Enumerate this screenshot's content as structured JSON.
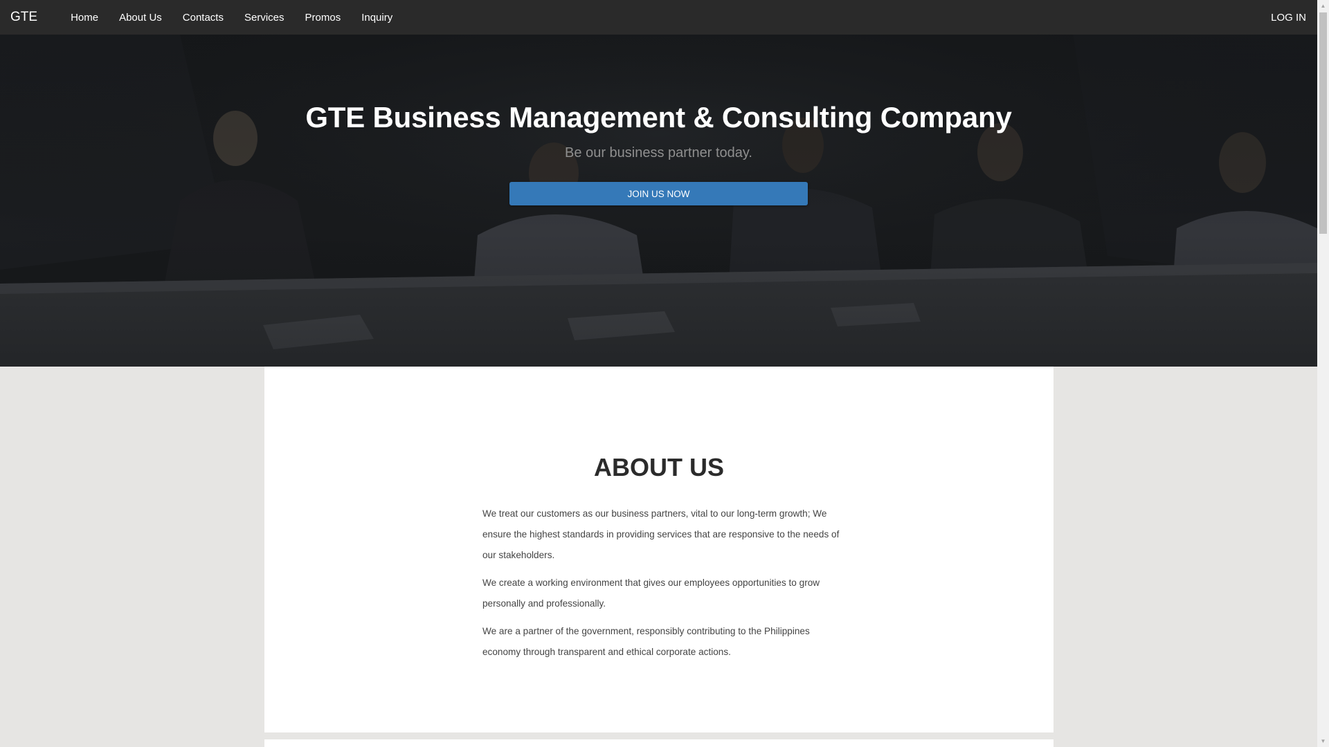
{
  "nav": {
    "brand": "GTE",
    "links": [
      "Home",
      "About Us",
      "Contacts",
      "Services",
      "Promos",
      "Inquiry"
    ],
    "login": "LOG IN"
  },
  "hero": {
    "title": "GTE Business Management & Consulting Company",
    "subtitle": "Be our business partner today.",
    "cta": "JOIN US NOW"
  },
  "about": {
    "title": "ABOUT US",
    "paragraphs": [
      "We treat our customers as our business partners, vital to our long-term growth; We ensure the highest standards in providing services that are responsive to the needs of our stakeholders.",
      "We create a working environment that gives our employees opportunities to grow personally and professionally.",
      "We are a partner of the government, responsibly contributing to the Philippines economy through transparent and ethical corporate actions."
    ]
  },
  "colors": {
    "navbar": "#2a2a2a",
    "button": "#3579b8",
    "page_background": "#e6e5e3"
  },
  "icons": {
    "scroll_up": "scroll-up-arrow-icon",
    "scroll_down": "scroll-down-arrow-icon"
  }
}
